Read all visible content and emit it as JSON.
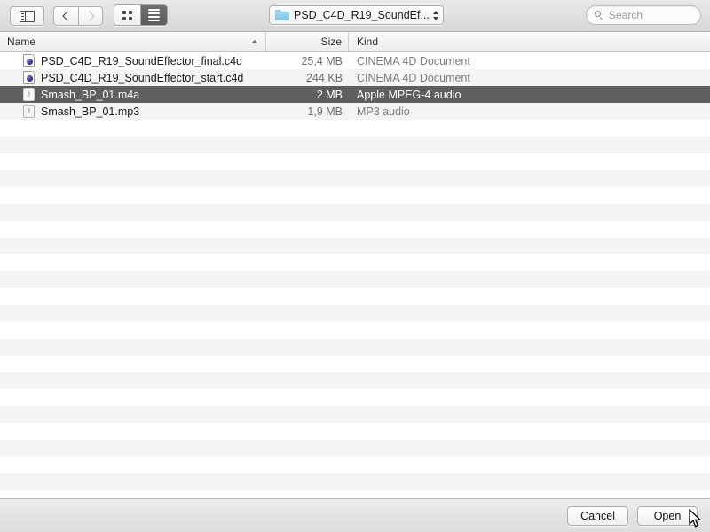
{
  "toolbar": {
    "sidebar_toggle_name": "sidebar-toggle",
    "back_label": "Back",
    "forward_label": "Forward",
    "view_icon_label": "Icon View",
    "view_list_label": "List View",
    "path_label": "PSD_C4D_R19_SoundEf...",
    "search": {
      "placeholder": "Search",
      "value": ""
    }
  },
  "columns": {
    "name": "Name",
    "size": "Size",
    "kind": "Kind",
    "sort_column": "Name",
    "sort_direction": "ascending"
  },
  "files": [
    {
      "name": "PSD_C4D_R19_SoundEffector_final.c4d",
      "size": "25,4 MB",
      "kind": "CINEMA 4D Document",
      "icon": "c4d-document-icon",
      "selected": false
    },
    {
      "name": "PSD_C4D_R19_SoundEffector_start.c4d",
      "size": "244 KB",
      "kind": "CINEMA 4D Document",
      "icon": "c4d-document-icon",
      "selected": false
    },
    {
      "name": "Smash_BP_01.m4a",
      "size": "2 MB",
      "kind": "Apple MPEG-4 audio",
      "icon": "audio-file-icon",
      "selected": true
    },
    {
      "name": "Smash_BP_01.mp3",
      "size": "1,9 MB",
      "kind": "MP3 audio",
      "icon": "audio-file-icon",
      "selected": false
    }
  ],
  "empty_row_count": 22,
  "footer": {
    "cancel_label": "Cancel",
    "open_label": "Open"
  },
  "colors": {
    "selection": "#5e5e5e",
    "stripe": "#f4f4f4",
    "folder_blue": "#76c2e4",
    "toolbar_top": "#e9e9e9",
    "toolbar_bottom": "#d7d7d7"
  }
}
